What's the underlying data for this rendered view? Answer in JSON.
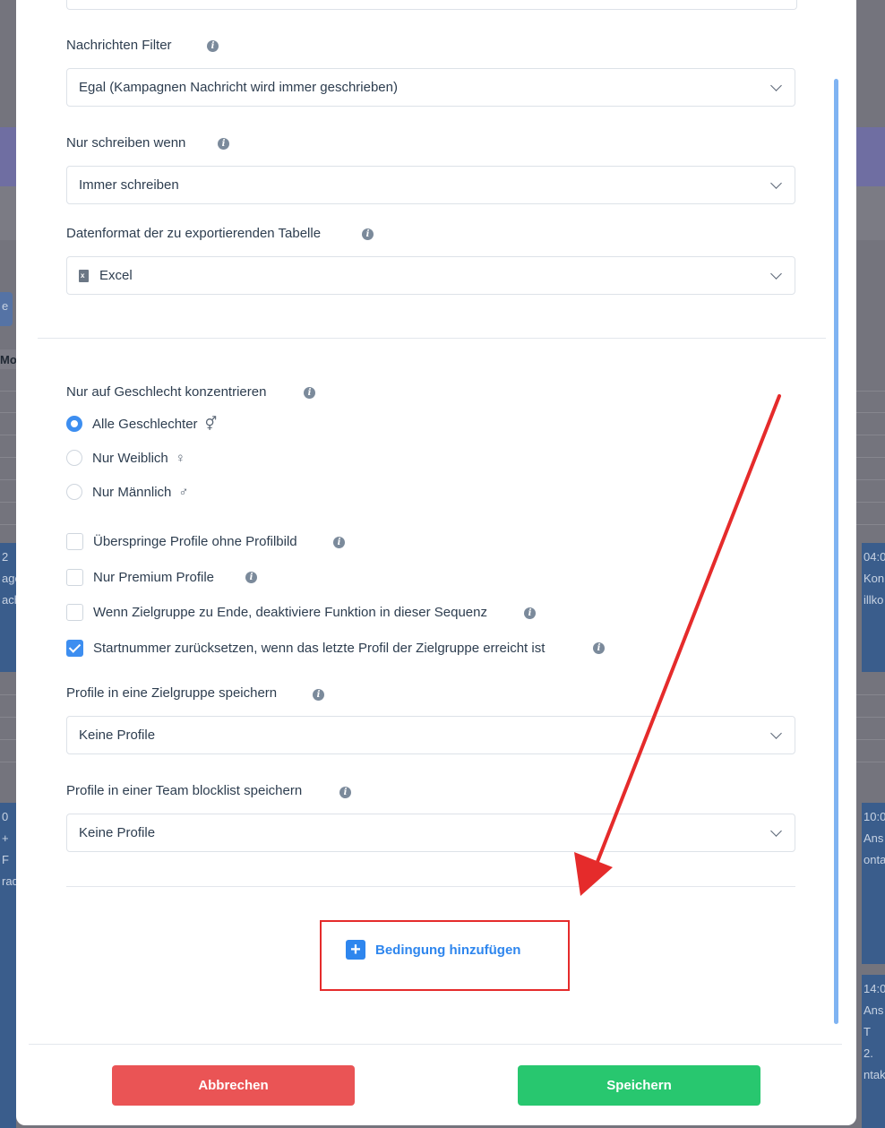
{
  "colors": {
    "accent": "#2e86ee",
    "cancel": "#ea5455",
    "save": "#28c76f",
    "annotation": "#e52b2b"
  },
  "fields": {
    "message_filter": {
      "label": "Nachrichten Filter",
      "value": "Egal (Kampagnen Nachricht wird immer geschrieben)"
    },
    "write_only_when": {
      "label": "Nur schreiben wenn",
      "value": "Immer schreiben"
    },
    "export_format": {
      "label": "Datenformat der zu exportierenden Tabelle",
      "value": "Excel",
      "icon": "excel-file-icon"
    },
    "gender_focus": {
      "label": "Nur auf Geschlecht konzentrieren",
      "options": [
        {
          "label": "Alle Geschlechter",
          "icon": "all-genders-icon",
          "symbol": "⚥",
          "selected": true
        },
        {
          "label": "Nur Weiblich",
          "icon": "female-icon",
          "symbol": "♀",
          "selected": false
        },
        {
          "label": "Nur Männlich",
          "icon": "male-icon",
          "symbol": "♂",
          "selected": false
        }
      ]
    },
    "checkboxes": [
      {
        "label": "Überspringe Profile ohne Profilbild",
        "checked": false
      },
      {
        "label": "Nur Premium Profile",
        "checked": false
      },
      {
        "label": "Wenn Zielgruppe zu Ende, deaktiviere Funktion in dieser Sequenz",
        "checked": false
      },
      {
        "label": "Startnummer zurücksetzen, wenn das letzte Profil der Zielgruppe erreicht ist",
        "checked": true
      }
    ],
    "save_to_target_group": {
      "label": "Profile in eine Zielgruppe speichern",
      "value": "Keine Profile"
    },
    "save_to_team_blocklist": {
      "label": "Profile in einer Team blocklist speichern",
      "value": "Keine Profile"
    }
  },
  "add_condition_label": "Bedingung hinzufügen",
  "buttons": {
    "cancel": "Abbrechen",
    "save": "Speichern"
  },
  "background_tiles": {
    "left_top": [
      "2",
      "age",
      "ach"
    ],
    "left_bottom": [
      "0",
      "+ F",
      "rad"
    ],
    "right_top": [
      "04:0",
      "Kon",
      "illko"
    ],
    "right_mid": [
      "10:0",
      "Ans",
      "onta"
    ],
    "right_bottom": [
      "14:0",
      "Ans",
      "T 2.",
      "ntak"
    ],
    "left_header": "Mo",
    "left_btn": "e"
  }
}
